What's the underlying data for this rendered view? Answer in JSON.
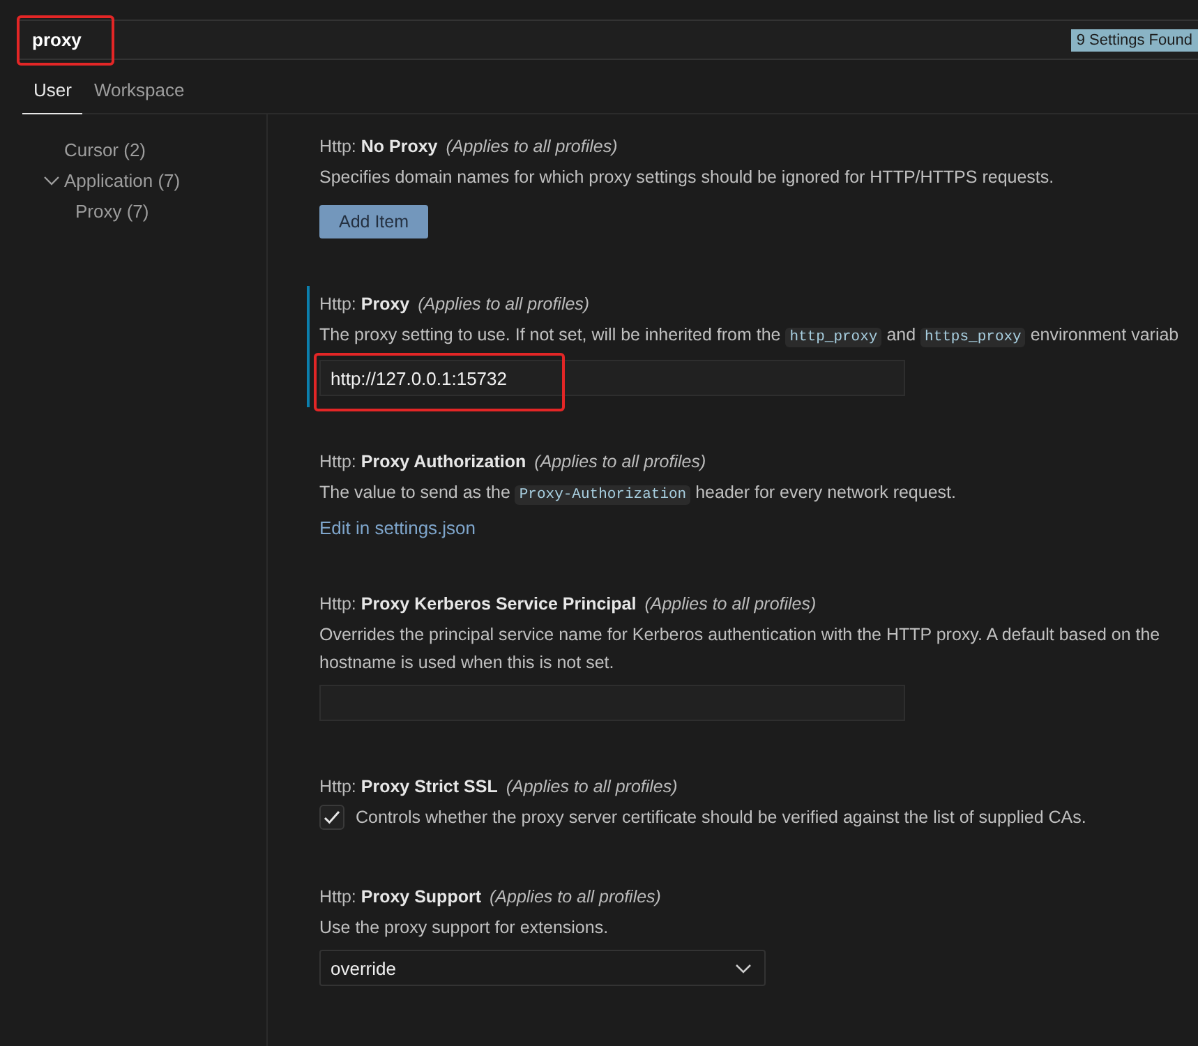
{
  "search": {
    "value": "proxy",
    "annotated": true,
    "result_count": "9 Settings Found"
  },
  "tabs": [
    {
      "label": "User",
      "selected": true
    },
    {
      "label": "Workspace",
      "selected": false
    }
  ],
  "toc": [
    {
      "label": "Cursor (2)"
    },
    {
      "label": "Application (7)",
      "expanded": true,
      "children": [
        {
          "label": "Proxy (7)"
        }
      ]
    }
  ],
  "settings": [
    {
      "kind": "list",
      "category": "Http:",
      "name": "No Proxy",
      "scope": "(Applies to all profiles)",
      "modified": false,
      "description": [
        {
          "kind": "text",
          "text": "Specifies domain names for which proxy settings should be ignored for HTTP/HTTPS requests."
        }
      ],
      "button": "Add Item"
    },
    {
      "kind": "text",
      "category": "Http:",
      "name": "Proxy",
      "scope": "(Applies to all profiles)",
      "modified": true,
      "description": [
        {
          "kind": "text",
          "text": "The proxy setting to use. If not set, will be inherited from the "
        },
        {
          "kind": "code",
          "text": "http_proxy"
        },
        {
          "kind": "text",
          "text": " and "
        },
        {
          "kind": "code",
          "text": "https_proxy"
        },
        {
          "kind": "text",
          "text": " environment variab"
        }
      ],
      "value": "http://127.0.0.1:15732",
      "annotated": true
    },
    {
      "kind": "link",
      "category": "Http:",
      "name": "Proxy Authorization",
      "scope": "(Applies to all profiles)",
      "modified": false,
      "description": [
        {
          "kind": "text",
          "text": "The value to send as the "
        },
        {
          "kind": "code",
          "text": "Proxy-Authorization"
        },
        {
          "kind": "text",
          "text": " header for every network request."
        }
      ],
      "link": "Edit in settings.json"
    },
    {
      "kind": "text",
      "category": "Http:",
      "name": "Proxy Kerberos Service Principal",
      "scope": "(Applies to all profiles)",
      "modified": false,
      "description": [
        {
          "kind": "text",
          "text": "Overrides the principal service name for Kerberos authentication with the HTTP proxy. A default based on the hostname is used when this is not set."
        }
      ]
    },
    {
      "kind": "checkbox",
      "category": "Http:",
      "name": "Proxy Strict SSL",
      "scope": "(Applies to all profiles)",
      "modified": false,
      "checked": true,
      "label": "Controls whether the proxy server certificate should be verified against the list of supplied CAs."
    },
    {
      "kind": "select",
      "category": "Http:",
      "name": "Proxy Support",
      "scope": "(Applies to all profiles)",
      "modified": false,
      "description": [
        {
          "kind": "text",
          "text": "Use the proxy support for extensions."
        }
      ],
      "value": "override"
    }
  ]
}
